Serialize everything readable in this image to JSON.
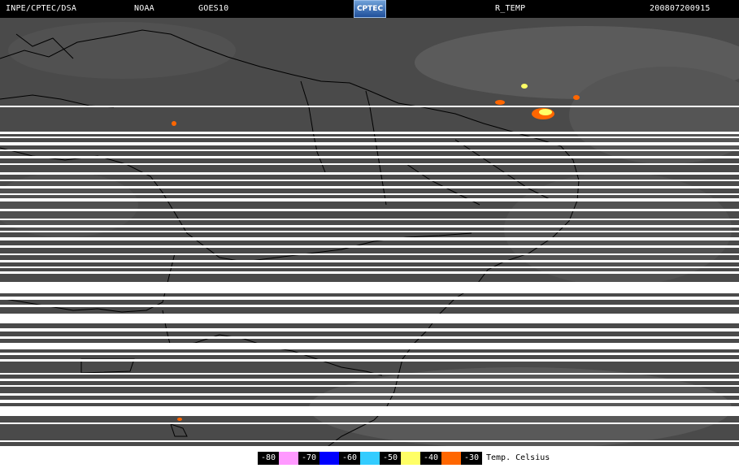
{
  "header": {
    "source": "INPE/CPTEC/DSA",
    "agency": "NOAA",
    "satellite": "GOES10",
    "logo_text": "CPTEC",
    "product": "R_TEMP",
    "timestamp": "200807200915"
  },
  "legend": {
    "items": [
      {
        "label": "-80",
        "color": "#ff99ff"
      },
      {
        "label": "-70",
        "color": "#0000ff"
      },
      {
        "label": "-60",
        "color": "#33ccff"
      },
      {
        "label": "-50",
        "color": "#ffff66"
      },
      {
        "label": "-40",
        "color": "#ff6600"
      },
      {
        "label": "-30",
        "color": null
      }
    ],
    "unit": "Temp. Celsius"
  },
  "map": {
    "background": "#4a4a4a",
    "coastline_color": "#000000",
    "scan_dropout_color": "#ffffff"
  }
}
